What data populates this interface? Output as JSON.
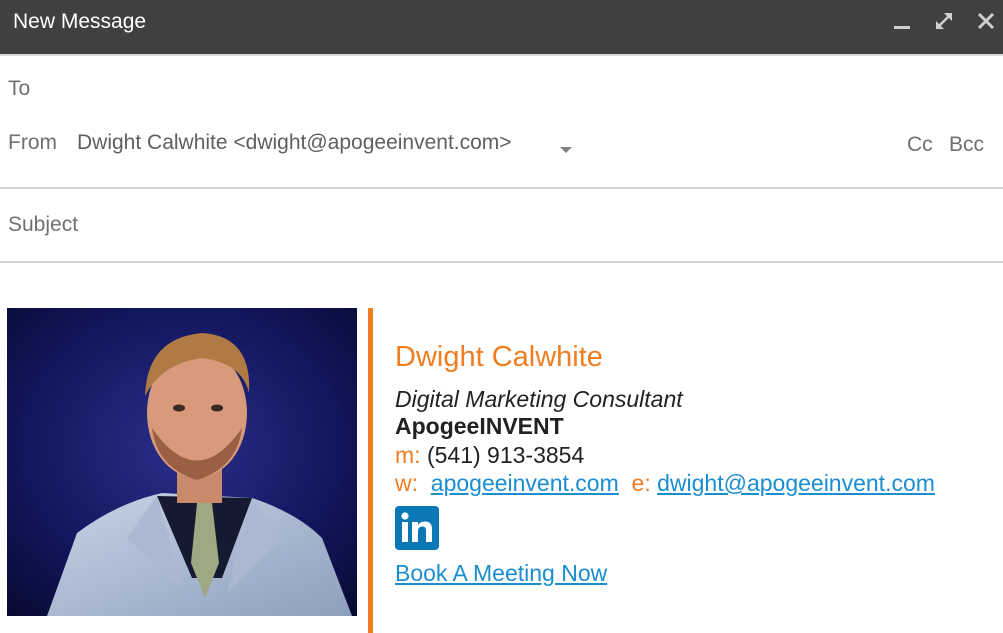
{
  "window": {
    "title": "New Message",
    "icons": [
      "minimize-icon",
      "maximize-icon",
      "close-icon"
    ]
  },
  "fields": {
    "to_label": "To",
    "from_label": "From",
    "from_value": "Dwight Calwhite <dwight@apogeeinvent.com>",
    "cc_label": "Cc",
    "bcc_label": "Bcc",
    "subject_placeholder": "Subject"
  },
  "signature": {
    "name": "Dwight Calwhite",
    "title": "Digital Marketing Consultant",
    "company": "ApogeeINVENT",
    "mobile_label": "m:",
    "mobile": "(541) 913-3854",
    "web_label": "w:",
    "website": "apogeeinvent.com",
    "email_label": "e:",
    "email": "dwight@apogeeinvent.com",
    "social_icon": "linkedin-icon",
    "cta": "Book A Meeting Now"
  },
  "colors": {
    "titlebar": "#404040",
    "accent": "#ef7d22",
    "link": "#1a8ed1",
    "linkedin": "#0a78b5"
  }
}
